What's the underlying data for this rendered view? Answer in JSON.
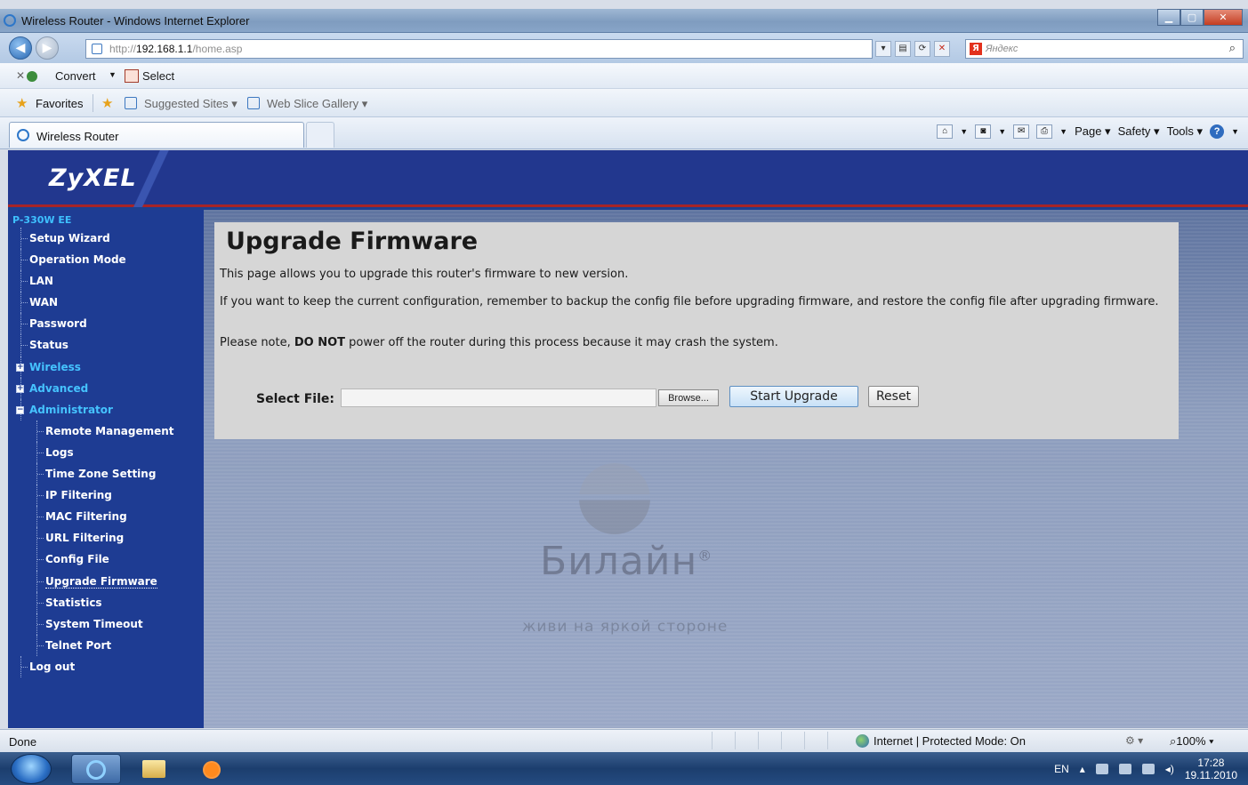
{
  "window": {
    "title": "Wireless Router - Windows Internet Explorer"
  },
  "address_bar": {
    "url_prefix": "http://",
    "url_host": "192.168.1.1",
    "url_path": "/home.asp",
    "search_placeholder": "Яндекс"
  },
  "toolbar": {
    "convert_label": "Convert",
    "select_label": "Select"
  },
  "favorites_bar": {
    "favorites_label": "Favorites",
    "suggested_sites_label": "Suggested Sites",
    "web_slice_label": "Web Slice Gallery"
  },
  "tab": {
    "title": "Wireless Router"
  },
  "command_bar": {
    "page_label": "Page",
    "safety_label": "Safety",
    "tools_label": "Tools"
  },
  "router": {
    "brand": "ZyXEL",
    "model": "P-330W EE",
    "menu": [
      {
        "label": "Setup Wizard",
        "level": 1
      },
      {
        "label": "Operation Mode",
        "level": 1
      },
      {
        "label": "LAN",
        "level": 1
      },
      {
        "label": "WAN",
        "level": 1
      },
      {
        "label": "Password",
        "level": 1
      },
      {
        "label": "Status",
        "level": 1
      },
      {
        "label": "Wireless",
        "level": 1,
        "folder": true
      },
      {
        "label": "Advanced",
        "level": 1,
        "folder": true
      },
      {
        "label": "Administrator",
        "level": 1,
        "folder": true,
        "expanded": true
      },
      {
        "label": "Remote Management",
        "level": 2
      },
      {
        "label": "Logs",
        "level": 2
      },
      {
        "label": "Time Zone Setting",
        "level": 2
      },
      {
        "label": "IP Filtering",
        "level": 2
      },
      {
        "label": "MAC Filtering",
        "level": 2
      },
      {
        "label": "URL Filtering",
        "level": 2
      },
      {
        "label": "Config File",
        "level": 2
      },
      {
        "label": "Upgrade Firmware",
        "level": 2,
        "active": true
      },
      {
        "label": "Statistics",
        "level": 2
      },
      {
        "label": "System Timeout",
        "level": 2
      },
      {
        "label": "Telnet Port",
        "level": 2
      },
      {
        "label": "Log out",
        "level": 1
      }
    ],
    "colors": {
      "banner": "#22378e",
      "sidebar": "#1e3c93",
      "folder_link": "#45c3ff",
      "banner_rule": "#a62427"
    }
  },
  "firmware": {
    "title": "Upgrade Firmware",
    "intro": "This page allows you to upgrade this router's firmware to new version.",
    "backup_note": "If you want to keep the current configuration, remember to backup the config file before upgrading firmware, and restore the config file after upgrading firmware.",
    "warning_prefix": "Please note, ",
    "warning_strong": "DO NOT",
    "warning_suffix": " power off the router during this process because it may crash the system.",
    "select_file_label": "Select File:",
    "file_value": "",
    "browse_label": "Browse...",
    "start_label": "Start Upgrade",
    "reset_label": "Reset"
  },
  "watermark": {
    "brand": "Билайн",
    "reg": "®",
    "tagline": "живи на яркой стороне"
  },
  "status_bar": {
    "status_text": "Done",
    "zone_text": "Internet | Protected Mode: On",
    "zoom_text": "100%"
  },
  "taskbar": {
    "language": "EN",
    "time": "17:28",
    "date": "19.11.2010"
  }
}
